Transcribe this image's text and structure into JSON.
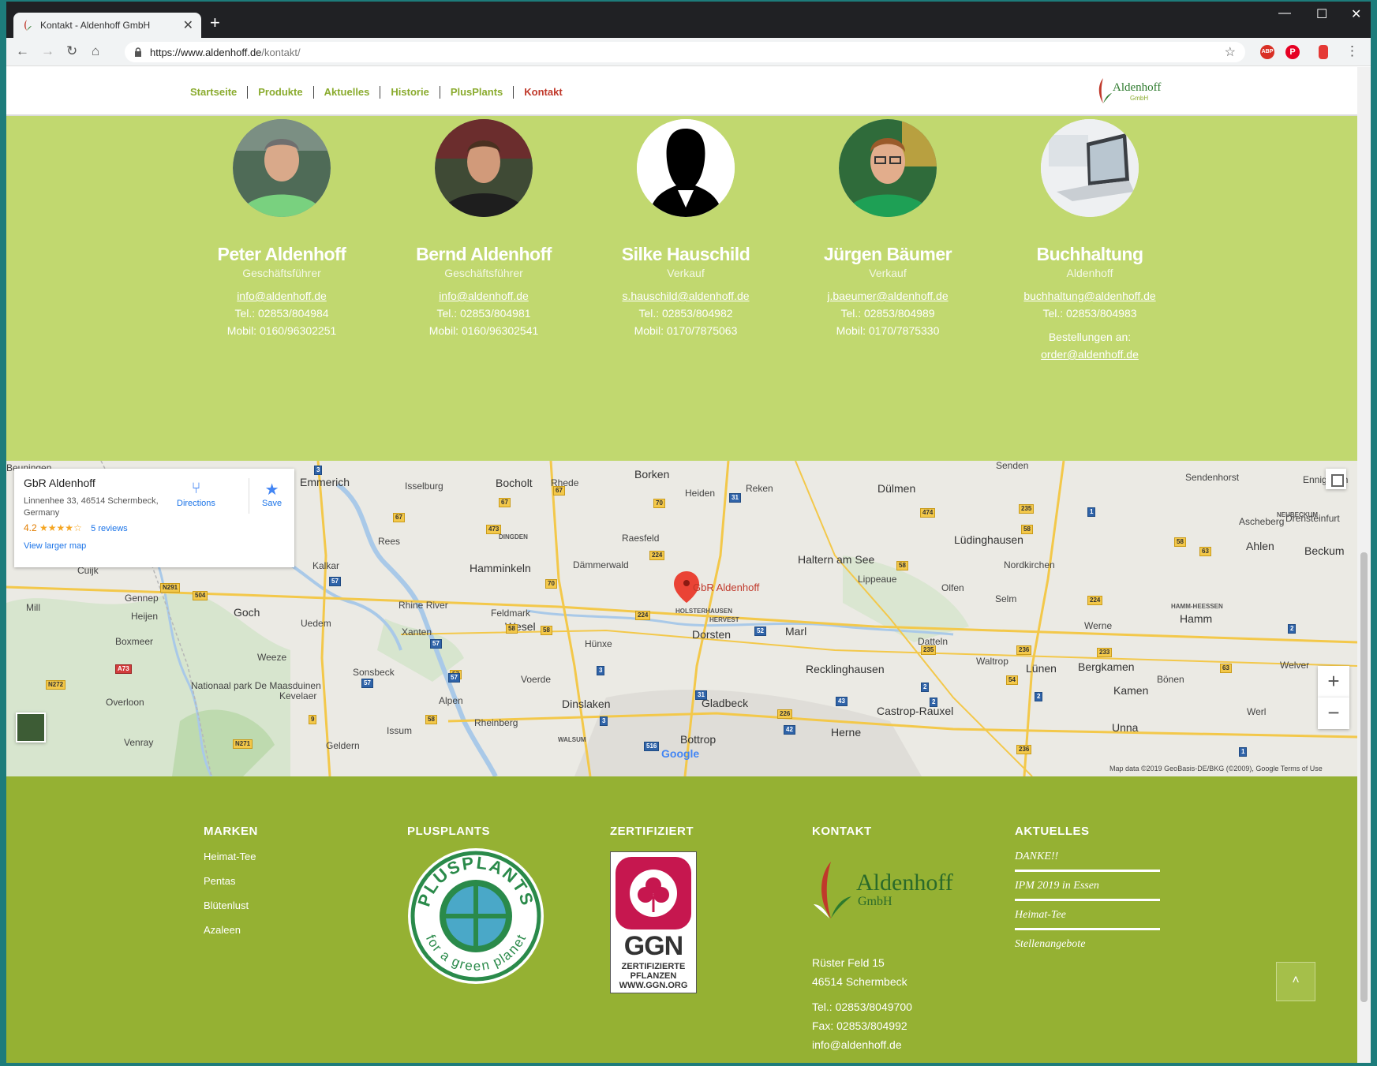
{
  "browser": {
    "tab_title": "Kontakt - Aldenhoff GmbH",
    "tab_close": "✕",
    "new_tab": "+",
    "url_host": "https://www.aldenhoff.de",
    "url_path": "/kontakt/",
    "minimize": "—",
    "maximize": "☐",
    "close": "✕"
  },
  "nav": {
    "links": [
      "Startseite",
      "Produkte",
      "Aktuelles",
      "Historie",
      "PlusPlants",
      "Kontakt"
    ],
    "active": "Kontakt",
    "brand": "Aldenhoff",
    "brand_sub": "GmbH"
  },
  "contacts": [
    {
      "name": "Peter Aldenhoff",
      "role": "Geschäftsführer",
      "email": "info@aldenhoff.de",
      "tel": "Tel.: 02853/804984",
      "mobil": "Mobil: 0160/96302251"
    },
    {
      "name": "Bernd Aldenhoff",
      "role": "Geschäftsführer",
      "email": "info@aldenhoff.de",
      "tel": "Tel.: 02853/804981",
      "mobil": "Mobil: 0160/96302541"
    },
    {
      "name": "Silke Hauschild",
      "role": "Verkauf",
      "email": "s.hauschild@aldenhoff.de",
      "tel": "Tel.: 02853/804982",
      "mobil": "Mobil: 0170/7875063"
    },
    {
      "name": "Jürgen Bäumer",
      "role": "Verkauf",
      "email": "j.baeumer@aldenhoff.de",
      "tel": "Tel.: 02853/804989",
      "mobil": "Mobil: 0170/7875330"
    },
    {
      "name": "Buchhaltung",
      "role": "Aldenhoff",
      "email": "buchhaltung@aldenhoff.de",
      "tel": "Tel.: 02853/804983",
      "orders_label": "Bestellungen an:",
      "orders_email": "order@aldenhoff.de"
    }
  ],
  "map": {
    "place_name": "GbR Aldenhoff",
    "address": "Linnenhee 33, 46514 Schermbeck, Germany",
    "rating": "4.2",
    "stars": "★★★★☆",
    "reviews": "5 reviews",
    "directions": "Directions",
    "save": "Save",
    "larger_map": "View larger map",
    "marker_label": "GbR Aldenhoff",
    "zoom_in": "+",
    "zoom_out": "−",
    "google": "Google",
    "credit": "Map data ©2019 GeoBasis-DE/BKG (©2009), Google    Terms of Use",
    "towns": [
      {
        "name": "Beuningen",
        "cls": "",
        "pos": [
          0,
          0
        ]
      },
      {
        "name": "Emmerich",
        "cls": "big",
        "pos": [
          0,
          0
        ]
      },
      {
        "name": "Isselburg",
        "cls": "",
        "pos": [
          0,
          0
        ]
      },
      {
        "name": "Bocholt",
        "cls": "big",
        "pos": [
          0,
          0
        ]
      },
      {
        "name": "Rhede",
        "cls": "",
        "pos": [
          0,
          0
        ]
      },
      {
        "name": "Borken",
        "cls": "big",
        "pos": [
          0,
          0
        ]
      },
      {
        "name": "Heiden",
        "cls": "",
        "pos": [
          0,
          0
        ]
      },
      {
        "name": "Reken",
        "cls": "",
        "pos": [
          0,
          0
        ]
      },
      {
        "name": "Dülmen",
        "cls": "big",
        "pos": [
          0,
          0
        ]
      },
      {
        "name": "Senden",
        "cls": "",
        "pos": [
          0,
          0
        ]
      },
      {
        "name": "Sendenhorst",
        "cls": "",
        "pos": [
          0,
          0
        ]
      },
      {
        "name": "Ennigerloh",
        "cls": "",
        "pos": [
          0,
          0
        ]
      },
      {
        "name": "Rees",
        "cls": "",
        "pos": [
          0,
          0
        ]
      },
      {
        "name": "DINGDEN",
        "cls": "small",
        "pos": [
          0,
          0
        ]
      },
      {
        "name": "Raesfeld",
        "cls": "",
        "pos": [
          0,
          0
        ]
      },
      {
        "name": "Ascheberg",
        "cls": "",
        "pos": [
          0,
          0
        ]
      },
      {
        "name": "Drensteinfurt",
        "cls": "",
        "pos": [
          0,
          0
        ]
      },
      {
        "name": "Lüdinghausen",
        "cls": "big",
        "pos": [
          0,
          0
        ]
      },
      {
        "name": "Ahlen",
        "cls": "big",
        "pos": [
          0,
          0
        ]
      },
      {
        "name": "Beckum",
        "cls": "big",
        "pos": [
          0,
          0
        ]
      },
      {
        "name": "NEUBECKUM",
        "cls": "small",
        "pos": [
          0,
          0
        ]
      },
      {
        "name": "Cuijk",
        "cls": "",
        "pos": [
          0,
          0
        ]
      },
      {
        "name": "Kalkar",
        "cls": "",
        "pos": [
          0,
          0
        ]
      },
      {
        "name": "Hamminkeln",
        "cls": "big",
        "pos": [
          0,
          0
        ]
      },
      {
        "name": "Dämmerwald",
        "cls": "",
        "pos": [
          0,
          0
        ]
      },
      {
        "name": "Haltern am See",
        "cls": "big",
        "pos": [
          0,
          0
        ]
      },
      {
        "name": "Nordkirchen",
        "cls": "",
        "pos": [
          0,
          0
        ]
      },
      {
        "name": "Lippeaue",
        "cls": "",
        "pos": [
          0,
          0
        ]
      },
      {
        "name": "Olfen",
        "cls": "",
        "pos": [
          0,
          0
        ]
      },
      {
        "name": "Gennep",
        "cls": "",
        "pos": [
          0,
          0
        ]
      },
      {
        "name": "Mill",
        "cls": "",
        "pos": [
          0,
          0
        ]
      },
      {
        "name": "Heijen",
        "cls": "",
        "pos": [
          0,
          0
        ]
      },
      {
        "name": "Goch",
        "cls": "big",
        "pos": [
          0,
          0
        ]
      },
      {
        "name": "Uedem",
        "cls": "",
        "pos": [
          0,
          0
        ]
      },
      {
        "name": "Rhine River",
        "cls": "",
        "pos": [
          0,
          0
        ]
      },
      {
        "name": "Feldmark",
        "cls": "",
        "pos": [
          0,
          0
        ]
      },
      {
        "name": "Wesel",
        "cls": "big",
        "pos": [
          0,
          0
        ]
      },
      {
        "name": "HOLSTERHAUSEN",
        "cls": "small",
        "pos": [
          0,
          0
        ]
      },
      {
        "name": "HERVEST",
        "cls": "small",
        "pos": [
          0,
          0
        ]
      },
      {
        "name": "Dorsten",
        "cls": "big",
        "pos": [
          0,
          0
        ]
      },
      {
        "name": "Marl",
        "cls": "big",
        "pos": [
          0,
          0
        ]
      },
      {
        "name": "Selm",
        "cls": "",
        "pos": [
          0,
          0
        ]
      },
      {
        "name": "HAMM-HEESSEN",
        "cls": "small",
        "pos": [
          0,
          0
        ]
      },
      {
        "name": "Hamm",
        "cls": "big",
        "pos": [
          0,
          0
        ]
      },
      {
        "name": "Boxmeer",
        "cls": "",
        "pos": [
          0,
          0
        ]
      },
      {
        "name": "Xanten",
        "cls": "",
        "pos": [
          0,
          0
        ]
      },
      {
        "name": "Hünxe",
        "cls": "",
        "pos": [
          0,
          0
        ]
      },
      {
        "name": "Datteln",
        "cls": "",
        "pos": [
          0,
          0
        ]
      },
      {
        "name": "Werne",
        "cls": "",
        "pos": [
          0,
          0
        ]
      },
      {
        "name": "Weeze",
        "cls": "",
        "pos": [
          0,
          0
        ]
      },
      {
        "name": "Recklinghausen",
        "cls": "big",
        "pos": [
          0,
          0
        ]
      },
      {
        "name": "Waltrop",
        "cls": "",
        "pos": [
          0,
          0
        ]
      },
      {
        "name": "Lünen",
        "cls": "big",
        "pos": [
          0,
          0
        ]
      },
      {
        "name": "Bergkamen",
        "cls": "big",
        "pos": [
          0,
          0
        ]
      },
      {
        "name": "Welver",
        "cls": "",
        "pos": [
          0,
          0
        ]
      },
      {
        "name": "Sonsbeck",
        "cls": "",
        "pos": [
          0,
          0
        ]
      },
      {
        "name": "Voerde",
        "cls": "",
        "pos": [
          0,
          0
        ]
      },
      {
        "name": "Nationaal park De Maasduinen",
        "cls": "",
        "pos": [
          0,
          0
        ]
      },
      {
        "name": "Kevelaer",
        "cls": "",
        "pos": [
          0,
          0
        ]
      },
      {
        "name": "Alpen",
        "cls": "",
        "pos": [
          0,
          0
        ]
      },
      {
        "name": "Dinslaken",
        "cls": "big",
        "pos": [
          0,
          0
        ]
      },
      {
        "name": "Gladbeck",
        "cls": "big",
        "pos": [
          0,
          0
        ]
      },
      {
        "name": "Castrop-Rauxel",
        "cls": "big",
        "pos": [
          0,
          0
        ]
      },
      {
        "name": "Kamen",
        "cls": "big",
        "pos": [
          0,
          0
        ]
      },
      {
        "name": "Bönen",
        "cls": "",
        "pos": [
          0,
          0
        ]
      },
      {
        "name": "Overloon",
        "cls": "",
        "pos": [
          0,
          0
        ]
      },
      {
        "name": "Rheinberg",
        "cls": "",
        "pos": [
          0,
          0
        ]
      },
      {
        "name": "Herne",
        "cls": "big",
        "pos": [
          0,
          0
        ]
      },
      {
        "name": "Werl",
        "cls": "",
        "pos": [
          0,
          0
        ]
      },
      {
        "name": "Issum",
        "cls": "",
        "pos": [
          0,
          0
        ]
      },
      {
        "name": "Unna",
        "cls": "big",
        "pos": [
          0,
          0
        ]
      },
      {
        "name": "Venray",
        "cls": "",
        "pos": [
          0,
          0
        ]
      },
      {
        "name": "Geldern",
        "cls": "",
        "pos": [
          0,
          0
        ]
      },
      {
        "name": "WALSUM",
        "cls": "small",
        "pos": [
          0,
          0
        ]
      },
      {
        "name": "Bottrop",
        "cls": "big",
        "pos": [
          0,
          0
        ]
      }
    ],
    "roads": [
      "3",
      "67",
      "67",
      "70",
      "31",
      "474",
      "235",
      "1",
      "67",
      "473",
      "224",
      "58",
      "58",
      "63",
      "N271",
      "N291",
      "504",
      "57",
      "70",
      "58",
      "224",
      "58",
      "224",
      "52",
      "2",
      "57",
      "58",
      "57",
      "3",
      "235",
      "236",
      "233",
      "A73",
      "N272",
      "57",
      "57",
      "31",
      "43",
      "2",
      "2",
      "54",
      "63",
      "9",
      "58",
      "3",
      "2",
      "226",
      "42",
      "516",
      "236",
      "N271",
      "1"
    ]
  },
  "footer": {
    "marken_title": "MARKEN",
    "marken": [
      "Heimat-Tee",
      "Pentas",
      "Blütenlust",
      "Azaleen"
    ],
    "plusplants_title": "PLUSPLANTS",
    "plusplants_ring": "PLUSPLANTS",
    "plusplants_sub": "for a green planet",
    "zert_title": "ZERTIFIZIERT",
    "ggn_word": "GGN",
    "ggn_line1": "ZERTIFIZIERTE",
    "ggn_line2": "PFLANZEN",
    "ggn_line3": "WWW.GGN.ORG",
    "kontakt_title": "KONTAKT",
    "kontakt_brand": "Aldenhoff",
    "kontakt_brand_sub": "GmbH",
    "street": "Rüster Feld 15",
    "city": "46514 Schermbeck",
    "tel": "Tel.: 02853/8049700",
    "fax": "Fax: 02853/804992",
    "email": "info@aldenhoff.de",
    "aktuelles_title": "AKTUELLES",
    "aktuelles": [
      "DANKE!!",
      "IPM 2019 in Essen",
      "Heimat-Tee",
      "Stellenangebote"
    ],
    "totop": "˄"
  },
  "colors": {
    "contact_bg": "#c1d86f",
    "footer_bg": "#95b133",
    "nav_green": "#8aab2e",
    "nav_active": "#c0392b"
  }
}
